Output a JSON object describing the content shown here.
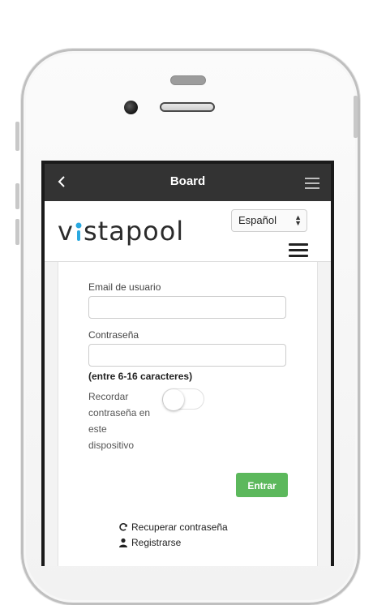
{
  "app": {
    "title": "Board"
  },
  "header": {
    "logo_text": "vistapool",
    "language": "Español"
  },
  "form": {
    "email_label": "Email de usuario",
    "email_value": "",
    "password_label": "Contraseña",
    "password_value": "",
    "password_hint": "(entre 6-16 caracteres)",
    "remember_label": "Recordar contraseña en este dispositivo",
    "remember_on": false,
    "submit_label": "Entrar"
  },
  "links": {
    "recover": "Recuperar contraseña",
    "register": "Registrarse"
  },
  "colors": {
    "topbar": "#333333",
    "accent": "#5cb85c",
    "logo_dot": "#2aa9e0"
  },
  "icons": [
    "back-arrow-icon",
    "menu-icon",
    "refresh-icon",
    "user-icon",
    "select-caret-icon"
  ]
}
